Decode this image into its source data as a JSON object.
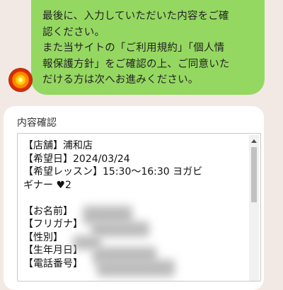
{
  "message": {
    "text": "最後に、入力していただいた内容をご確\n認ください。\nまた当サイトの「ご利用規約」「個人情\n報保護方針」をご確認の上、ご同意いた\nだける方は次へお進みください。"
  },
  "avatar": {
    "icon": "sun-avatar-icon"
  },
  "confirmation": {
    "title": "内容確認",
    "body": "【店舗】浦和店\n【希望日】2024/03/24\n【希望レッスン】15:30～16:30 ヨガビ\nギナー ♥2\n\n【お名前】\n【フリガナ】\n【性別】\n【生年月日】\n【電話番号】"
  },
  "colors": {
    "background": "#f3e9e4",
    "bubble": "#95d861",
    "card": "#ffffff"
  }
}
